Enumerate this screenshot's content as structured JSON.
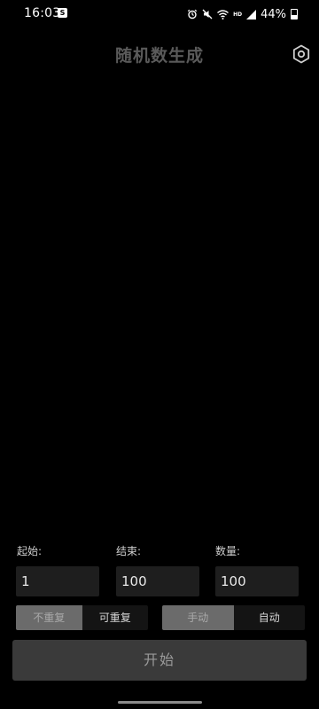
{
  "status_bar": {
    "time": "16:03",
    "notification_badge": "S",
    "network_label": "HD",
    "battery_percent": "44%"
  },
  "header": {
    "title": "随机数生成",
    "settings_icon": "gear-icon"
  },
  "form": {
    "start_label": "起始:",
    "start_value": "1",
    "end_label": "结束:",
    "end_value": "100",
    "count_label": "数量:",
    "count_value": "100"
  },
  "repeat_toggle": {
    "options": [
      "不重复",
      "可重复"
    ],
    "selected": "不重复"
  },
  "mode_toggle": {
    "options": [
      "手动",
      "自动"
    ],
    "selected": "手动"
  },
  "actions": {
    "start_label": "开始"
  },
  "colors": {
    "background": "#000000",
    "title": "#5a5a5a",
    "input_bg": "#1e1e1e",
    "segment_active": "#6b6b6b",
    "button_bg": "#3a3a3a"
  }
}
